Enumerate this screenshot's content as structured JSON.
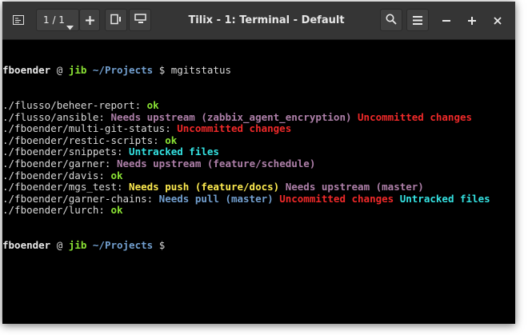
{
  "window": {
    "title": "Tilix - 1: Terminal - Default",
    "session_label": "1 / 1"
  },
  "terminal": {
    "prompt": {
      "user": "fboender",
      "at": " @ ",
      "host": "jib",
      "cwd": " ~/Projects",
      "symbol": " $ "
    },
    "command": "mgitstatus",
    "lines": [
      [
        {
          "t": "./flusso/beheer-report: ",
          "c": "path"
        },
        {
          "t": "ok",
          "c": "ok"
        }
      ],
      [
        {
          "t": "./flusso/ansible: ",
          "c": "path"
        },
        {
          "t": "Needs upstream (zabbix_agent_encryption)",
          "c": "needs-up"
        },
        {
          "t": " ",
          "c": "path"
        },
        {
          "t": "Uncommitted changes",
          "c": "uncommitted"
        }
      ],
      [
        {
          "t": "./fboender/multi-git-status: ",
          "c": "path"
        },
        {
          "t": "Uncommitted changes",
          "c": "uncommitted"
        }
      ],
      [
        {
          "t": "./fboender/restic-scripts: ",
          "c": "path"
        },
        {
          "t": "ok",
          "c": "ok"
        }
      ],
      [
        {
          "t": "./fboender/snippets: ",
          "c": "path"
        },
        {
          "t": "Untracked files",
          "c": "untracked"
        }
      ],
      [
        {
          "t": "./fboender/garner: ",
          "c": "path"
        },
        {
          "t": "Needs upstream (feature/schedule)",
          "c": "needs-up"
        }
      ],
      [
        {
          "t": "./fboender/davis: ",
          "c": "path"
        },
        {
          "t": "ok",
          "c": "ok"
        }
      ],
      [
        {
          "t": "./fboender/mgs_test: ",
          "c": "path"
        },
        {
          "t": "Needs push (feature/docs)",
          "c": "needs-push"
        },
        {
          "t": " ",
          "c": "path"
        },
        {
          "t": "Needs upstream (master)",
          "c": "needs-up"
        }
      ],
      [
        {
          "t": "./fboender/garner-chains: ",
          "c": "path"
        },
        {
          "t": "Needs pull (master)",
          "c": "needs-pull"
        },
        {
          "t": " ",
          "c": "path"
        },
        {
          "t": "Uncommitted changes",
          "c": "uncommitted"
        },
        {
          "t": " ",
          "c": "path"
        },
        {
          "t": "Untracked files",
          "c": "untracked"
        }
      ],
      [
        {
          "t": "./fboender/lurch: ",
          "c": "path"
        },
        {
          "t": "ok",
          "c": "ok"
        }
      ]
    ]
  },
  "colors": {
    "titlebar": "#353535",
    "terminal_bg": "#000000",
    "ok": "#8ae234",
    "needs_upstream": "#ad7fa8",
    "needs_pull": "#729fcf",
    "needs_push": "#fce94f",
    "uncommitted": "#ef2929",
    "untracked": "#34e2e2"
  },
  "icons": {
    "session_switch": "terminal-sidebar-icon",
    "session_dropdown": "chevron-down-icon",
    "add_terminal": "plus-icon",
    "split_right": "split-right-icon",
    "split_down": "split-down-icon",
    "search": "search-icon",
    "menu": "hamburger-menu-icon",
    "minimize": "minimize-icon",
    "maximize": "maximize-icon",
    "close": "close-icon"
  }
}
